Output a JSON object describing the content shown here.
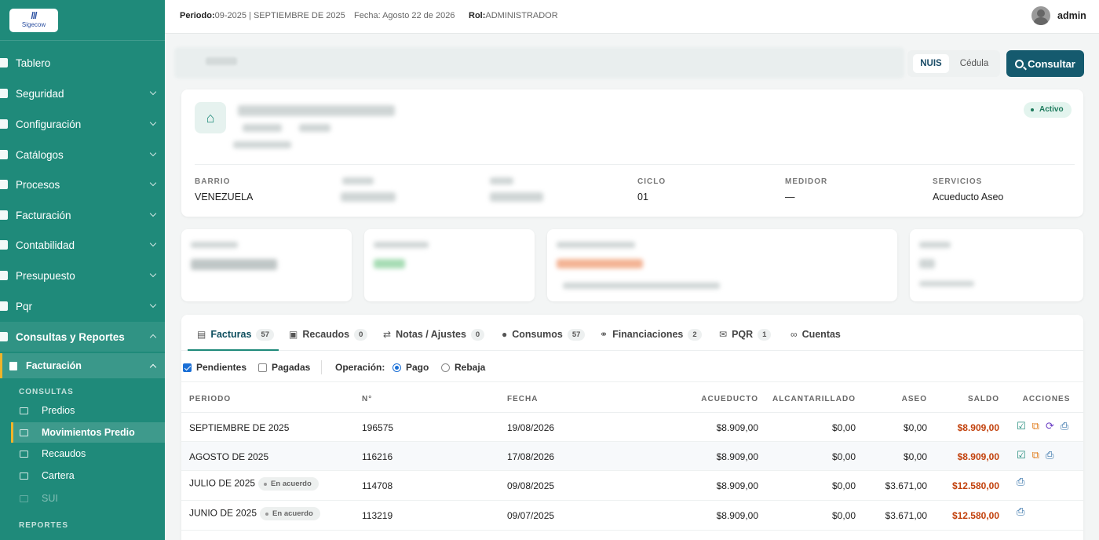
{
  "brand": {
    "logo_text": "Sigecow"
  },
  "topbar": {
    "periodo_label": "Periodo:",
    "periodo_value": "09-2025 | SEPTIEMBRE DE 2025",
    "fecha": "Fecha: Agosto 22 de 2026",
    "rol_label": "Rol:",
    "rol_value": "ADMINISTRADOR",
    "user": "admin"
  },
  "sidebar": {
    "items": [
      {
        "label": "Tablero"
      },
      {
        "label": "Seguridad"
      },
      {
        "label": "Configuración"
      },
      {
        "label": "Catálogos"
      },
      {
        "label": "Procesos"
      },
      {
        "label": "Facturación"
      },
      {
        "label": "Contabilidad"
      },
      {
        "label": "Presupuesto"
      },
      {
        "label": "Pqr"
      },
      {
        "label": "Consultas y Reportes"
      }
    ],
    "submenu": {
      "title": "Facturación",
      "consultas_label": "CONSULTAS",
      "consultas": [
        "Predios",
        "Movimientos Predio",
        "Recaudos",
        "Cartera",
        "SUI"
      ],
      "reportes_label": "REPORTES"
    }
  },
  "search": {
    "toggle_nuis": "NUIS",
    "toggle_cedula": "Cédula",
    "button": "Consultar"
  },
  "property": {
    "status": "Activo",
    "barrio_label": "BARRIO",
    "barrio": "VENEZUELA",
    "ciclo_label": "CICLO",
    "ciclo": "01",
    "medidor_label": "MEDIDOR",
    "medidor": "—",
    "servicios_label": "SERVICIOS",
    "servicios": "Acueducto Aseo"
  },
  "tabs": [
    {
      "label": "Facturas",
      "count": "57"
    },
    {
      "label": "Recaudos",
      "count": "0"
    },
    {
      "label": "Notas / Ajustes",
      "count": "0"
    },
    {
      "label": "Consumos",
      "count": "57"
    },
    {
      "label": "Financiaciones",
      "count": "2"
    },
    {
      "label": "PQR",
      "count": "1"
    },
    {
      "label": "Cuentas",
      "count": ""
    }
  ],
  "filters": {
    "pendientes": "Pendientes",
    "pagadas": "Pagadas",
    "operacion": "Operación:",
    "pago": "Pago",
    "rebaja": "Rebaja"
  },
  "table": {
    "headers": [
      "PERIODO",
      "N°",
      "FECHA",
      "ACUEDUCTO",
      "ALCANTARILLADO",
      "ASEO",
      "SALDO",
      "ACCIONES"
    ],
    "rows": [
      {
        "periodo": "SEPTIEMBRE DE 2025",
        "badge": "",
        "numero": "196575",
        "fecha": "19/08/2026",
        "acueducto": "$8.909,00",
        "alcantarillado": "$0,00",
        "aseo": "$0,00",
        "saldo": "$8.909,00"
      },
      {
        "periodo": "AGOSTO DE 2025",
        "badge": "",
        "numero": "116216",
        "fecha": "17/08/2026",
        "acueducto": "$8.909,00",
        "alcantarillado": "$0,00",
        "aseo": "$0,00",
        "saldo": "$8.909,00"
      },
      {
        "periodo": "JULIO DE 2025",
        "badge": "En acuerdo",
        "numero": "114708",
        "fecha": "09/08/2025",
        "acueducto": "$8.909,00",
        "alcantarillado": "$0,00",
        "aseo": "$3.671,00",
        "saldo": "$12.580,00"
      },
      {
        "periodo": "JUNIO DE 2025",
        "badge": "En acuerdo",
        "numero": "113219",
        "fecha": "09/07/2025",
        "acueducto": "$8.909,00",
        "alcantarillado": "$0,00",
        "aseo": "$3.671,00",
        "saldo": "$12.580,00"
      }
    ]
  },
  "colors": {
    "sidebar": "#1f8a7a",
    "primary_button": "#155a6e",
    "saldo": "#c2410c"
  }
}
